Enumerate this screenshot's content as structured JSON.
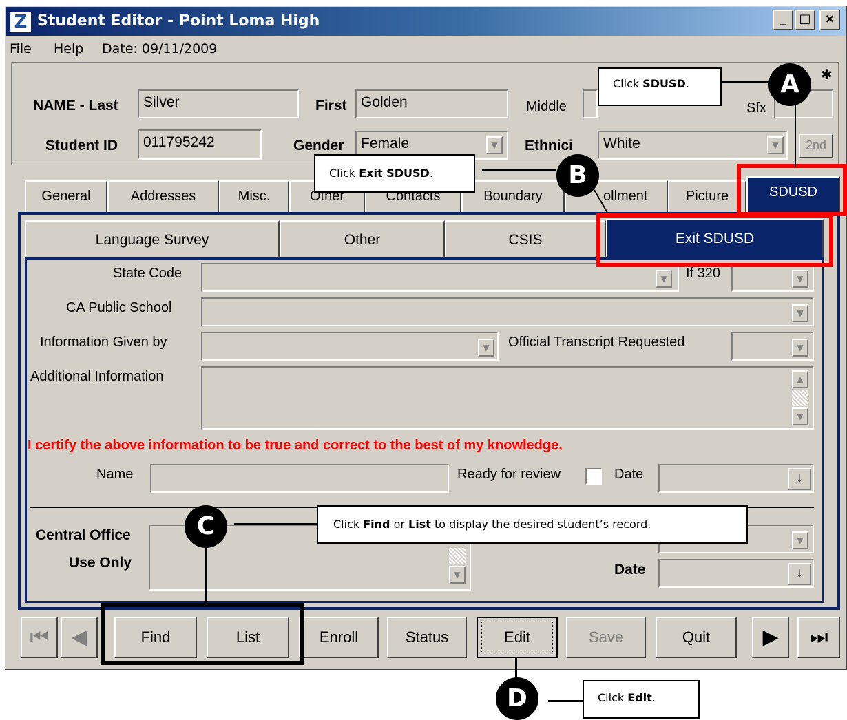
{
  "window": {
    "title": "Student Editor - Point Loma High",
    "icon_letter": "Z",
    "controls": [
      "_",
      "□",
      "×"
    ]
  },
  "menu": {
    "file": "File",
    "help": "Help",
    "date": "Date: 09/11/2009"
  },
  "header": {
    "name_last_label": "NAME - Last",
    "name_last_value": "Silver",
    "first_label": "First",
    "first_value": "Golden",
    "middle_label": "Middle",
    "middle_value": "",
    "sfx_label": "Sfx",
    "student_id_label": "Student ID",
    "student_id_value": "011795242",
    "gender_label": "Gender",
    "gender_value": "Female",
    "ethnicity_label": "Ethnici",
    "ethnicity_value": "White",
    "second_button": "2nd"
  },
  "tabs": [
    "General",
    "Addresses",
    "Misc.",
    "Other",
    "Contacts",
    "Boundary",
    "ollment",
    "Picture",
    "SDUSD"
  ],
  "subtabs": [
    "Language Survey",
    "Other",
    "CSIS",
    "Exit SDUSD"
  ],
  "form": {
    "state_code_label": "State Code",
    "if320_label": "If 320",
    "ca_public_school_label": "CA Public School",
    "information_given_label": "Information Given by",
    "official_transcript_label": "Official Transcript Requested",
    "additional_info_label": "Additional Information",
    "certify_text": "I certify the above information to be true and correct to the best of my knowledge.",
    "name_label": "Name",
    "ready_review_label": "Ready for review",
    "date_label": "Date",
    "central_office_label": "Central Office",
    "use_only_label": "Use Only",
    "date2_label": "Date"
  },
  "nav_buttons": {
    "find": "Find",
    "list": "List",
    "enroll": "Enroll",
    "status": "Status",
    "edit": "Edit",
    "save": "Save",
    "quit": "Quit"
  },
  "callouts": {
    "a": {
      "marker": "A",
      "pre": "Click ",
      "bold": "SDUSD",
      "post": "."
    },
    "b": {
      "marker": "B",
      "pre": "Click ",
      "bold": "Exit SDUSD",
      "post": "."
    },
    "c": {
      "marker": "C",
      "pre": "Click ",
      "bold1": "Find",
      "mid": " or ",
      "bold2": "List",
      "post": " to display the desired student’s record."
    },
    "d": {
      "marker": "D",
      "pre": "Click ",
      "bold": "Edit",
      "post": "."
    }
  },
  "colors": {
    "title_start": "#0a246a",
    "title_end": "#a6caf0",
    "window_bg": "#d4d0c8",
    "panel_border": "#0a246a",
    "active_tab": "#0a246a",
    "certify_text": "#ff0000",
    "highlight": "#ff0000"
  }
}
